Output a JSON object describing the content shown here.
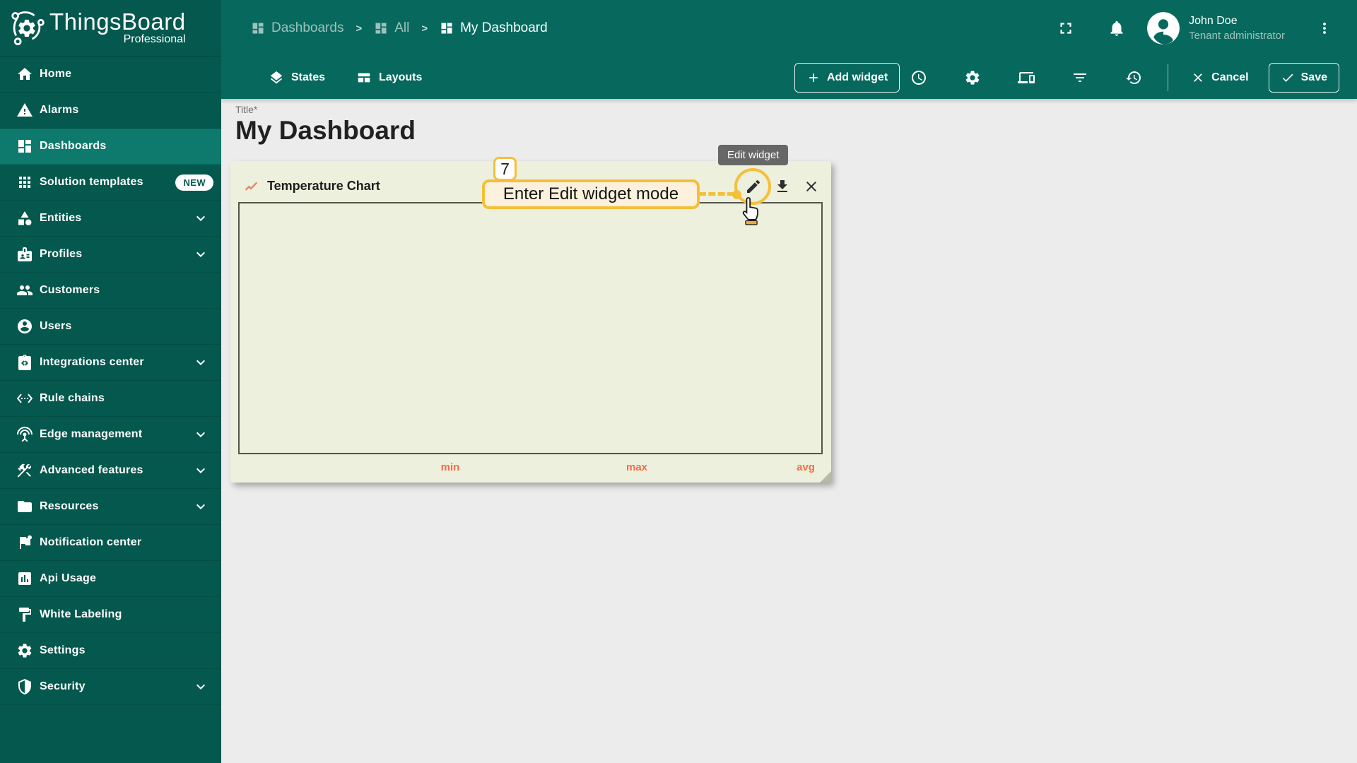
{
  "app": {
    "name": "ThingsBoard",
    "edition": "Professional"
  },
  "sidebar": {
    "items": [
      {
        "id": "home",
        "label": "Home",
        "icon": "home"
      },
      {
        "id": "alarms",
        "label": "Alarms",
        "icon": "warning"
      },
      {
        "id": "dashboards",
        "label": "Dashboards",
        "icon": "dashboards",
        "active": true
      },
      {
        "id": "solution-templates",
        "label": "Solution templates",
        "icon": "apps",
        "badge": "NEW"
      },
      {
        "id": "entities",
        "label": "Entities",
        "icon": "entities",
        "expandable": true
      },
      {
        "id": "profiles",
        "label": "Profiles",
        "icon": "profiles",
        "expandable": true
      },
      {
        "id": "customers",
        "label": "Customers",
        "icon": "customers"
      },
      {
        "id": "users",
        "label": "Users",
        "icon": "users"
      },
      {
        "id": "integrations-center",
        "label": "Integrations center",
        "icon": "integrations",
        "expandable": true
      },
      {
        "id": "rule-chains",
        "label": "Rule chains",
        "icon": "rule-chains"
      },
      {
        "id": "edge-management",
        "label": "Edge management",
        "icon": "edge",
        "expandable": true
      },
      {
        "id": "advanced-features",
        "label": "Advanced features",
        "icon": "tools",
        "expandable": true
      },
      {
        "id": "resources",
        "label": "Resources",
        "icon": "folder",
        "expandable": true
      },
      {
        "id": "notification-center",
        "label": "Notification center",
        "icon": "flag-dot"
      },
      {
        "id": "api-usage",
        "label": "Api Usage",
        "icon": "chart-box"
      },
      {
        "id": "white-labeling",
        "label": "White Labeling",
        "icon": "paint"
      },
      {
        "id": "settings",
        "label": "Settings",
        "icon": "gear"
      },
      {
        "id": "security",
        "label": "Security",
        "icon": "shield",
        "expandable": true
      }
    ]
  },
  "breadcrumb": {
    "separator": ">",
    "items": [
      {
        "label": "Dashboards",
        "icon": "dashboards",
        "current": false
      },
      {
        "label": "All",
        "icon": "dashboards",
        "current": false
      },
      {
        "label": "My Dashboard",
        "icon": "dashboards",
        "current": true
      }
    ]
  },
  "topbar": {
    "user": {
      "name": "John Doe",
      "role": "Tenant administrator"
    }
  },
  "toolbar": {
    "states_label": "States",
    "layouts_label": "Layouts",
    "add_widget_label": "Add widget",
    "icon_buttons": [
      {
        "name": "time-window",
        "icon": "clock"
      },
      {
        "name": "dashboard-settings",
        "icon": "gear"
      },
      {
        "name": "manage-layouts",
        "icon": "devices"
      },
      {
        "name": "entity-filter",
        "icon": "filter"
      },
      {
        "name": "version-history",
        "icon": "history"
      }
    ],
    "cancel_label": "Cancel",
    "save_label": "Save"
  },
  "page": {
    "title_label": "Title*",
    "title_value": "My Dashboard"
  },
  "widget": {
    "title": "Temperature Chart",
    "legend": [
      "min",
      "max",
      "avg"
    ]
  },
  "annotation": {
    "step": "7",
    "callout": "Enter Edit widget mode",
    "tooltip": "Edit widget"
  },
  "colors": {
    "header_teal": "#07695E",
    "sidebar_teal": "#04584E",
    "active_item_teal": "#0E7A6D",
    "widget_bg": "#EDF0DC",
    "accent_yellow": "#F5BF3B",
    "legend_orange": "#FB6B47",
    "title_icon_salmon": "#E2846B"
  }
}
